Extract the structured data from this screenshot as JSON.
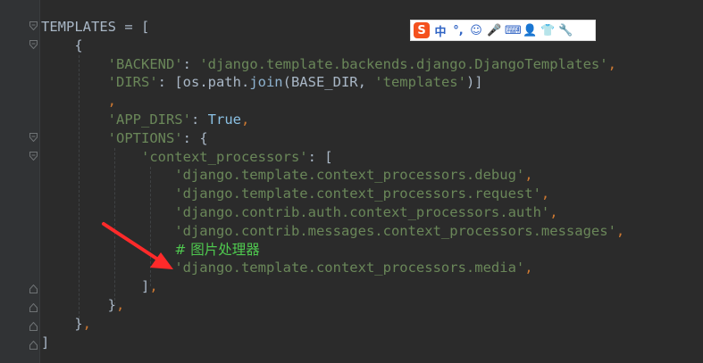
{
  "editor": {
    "lines": [
      {
        "indent": "",
        "tokens": [
          {
            "t": "TEMPLATES ",
            "c": ""
          },
          {
            "t": "= ",
            "c": ""
          },
          {
            "t": "[",
            "c": ""
          }
        ]
      },
      {
        "indent": "    ",
        "tokens": [
          {
            "t": "{",
            "c": ""
          }
        ]
      },
      {
        "indent": "        ",
        "tokens": [
          {
            "t": "'BACKEND'",
            "c": "str"
          },
          {
            "t": ": ",
            "c": ""
          },
          {
            "t": "'django.template.backends.django.DjangoTemplates'",
            "c": "str"
          },
          {
            "t": ",",
            "c": "pun"
          }
        ]
      },
      {
        "indent": "        ",
        "tokens": [
          {
            "t": "'DIRS'",
            "c": "str"
          },
          {
            "t": ": [os.path.",
            "c": ""
          },
          {
            "t": "join",
            "c": "fn"
          },
          {
            "t": "(BASE_DIR, ",
            "c": ""
          },
          {
            "t": "'templates'",
            "c": "str"
          },
          {
            "t": ")]",
            "c": ""
          }
        ]
      },
      {
        "indent": "        ",
        "tokens": [
          {
            "t": ",",
            "c": "pun"
          }
        ]
      },
      {
        "indent": "        ",
        "tokens": [
          {
            "t": "'APP_DIRS'",
            "c": "str"
          },
          {
            "t": ": ",
            "c": ""
          },
          {
            "t": "True",
            "c": "true"
          },
          {
            "t": ",",
            "c": "pun"
          }
        ]
      },
      {
        "indent": "        ",
        "tokens": [
          {
            "t": "'OPTIONS'",
            "c": "str"
          },
          {
            "t": ": {",
            "c": ""
          }
        ]
      },
      {
        "indent": "            ",
        "tokens": [
          {
            "t": "'context_processors'",
            "c": "str"
          },
          {
            "t": ": [",
            "c": ""
          }
        ]
      },
      {
        "indent": "                ",
        "tokens": [
          {
            "t": "'django.template.context_processors.debug'",
            "c": "str"
          },
          {
            "t": ",",
            "c": "pun"
          }
        ]
      },
      {
        "indent": "                ",
        "tokens": [
          {
            "t": "'django.template.context_processors.request'",
            "c": "str"
          },
          {
            "t": ",",
            "c": "pun"
          }
        ]
      },
      {
        "indent": "                ",
        "tokens": [
          {
            "t": "'django.contrib.auth.context_processors.auth'",
            "c": "str"
          },
          {
            "t": ",",
            "c": "pun"
          }
        ]
      },
      {
        "indent": "                ",
        "tokens": [
          {
            "t": "'django.contrib.messages.context_processors.messages'",
            "c": "str"
          },
          {
            "t": ",",
            "c": "pun"
          }
        ]
      },
      {
        "indent": "                ",
        "tokens": [
          {
            "t": "# 图片处理器",
            "c": "cmt"
          }
        ]
      },
      {
        "indent": "                ",
        "tokens": [
          {
            "t": "'django.template.context_processors.media'",
            "c": "str"
          },
          {
            "t": ",",
            "c": "pun"
          }
        ]
      },
      {
        "indent": "            ",
        "tokens": [
          {
            "t": "]",
            "c": ""
          },
          {
            "t": ",",
            "c": "pun"
          }
        ]
      },
      {
        "indent": "        ",
        "tokens": [
          {
            "t": "}",
            "c": ""
          },
          {
            "t": ",",
            "c": "pun"
          }
        ]
      },
      {
        "indent": "    ",
        "tokens": [
          {
            "t": "}",
            "c": ""
          },
          {
            "t": ",",
            "c": "pun"
          }
        ]
      },
      {
        "indent": "",
        "tokens": [
          {
            "t": "]",
            "c": ""
          }
        ]
      }
    ]
  },
  "ime_toolbar": {
    "logo": "S",
    "items": [
      {
        "label": "中",
        "name": "chinese-mode"
      },
      {
        "label": "°,",
        "name": "punctuation-mode"
      },
      {
        "label": "☺",
        "name": "emoji-icon"
      },
      {
        "label": "🎤",
        "name": "microphone-icon"
      },
      {
        "label": "⌨",
        "name": "keyboard-icon"
      },
      {
        "label": "👤",
        "name": "user-icon"
      },
      {
        "label": "👕",
        "name": "skin-icon"
      },
      {
        "label": "🔧",
        "name": "settings-wrench-icon"
      }
    ]
  },
  "annotation": {
    "arrow_color": "#ff2a2a"
  }
}
